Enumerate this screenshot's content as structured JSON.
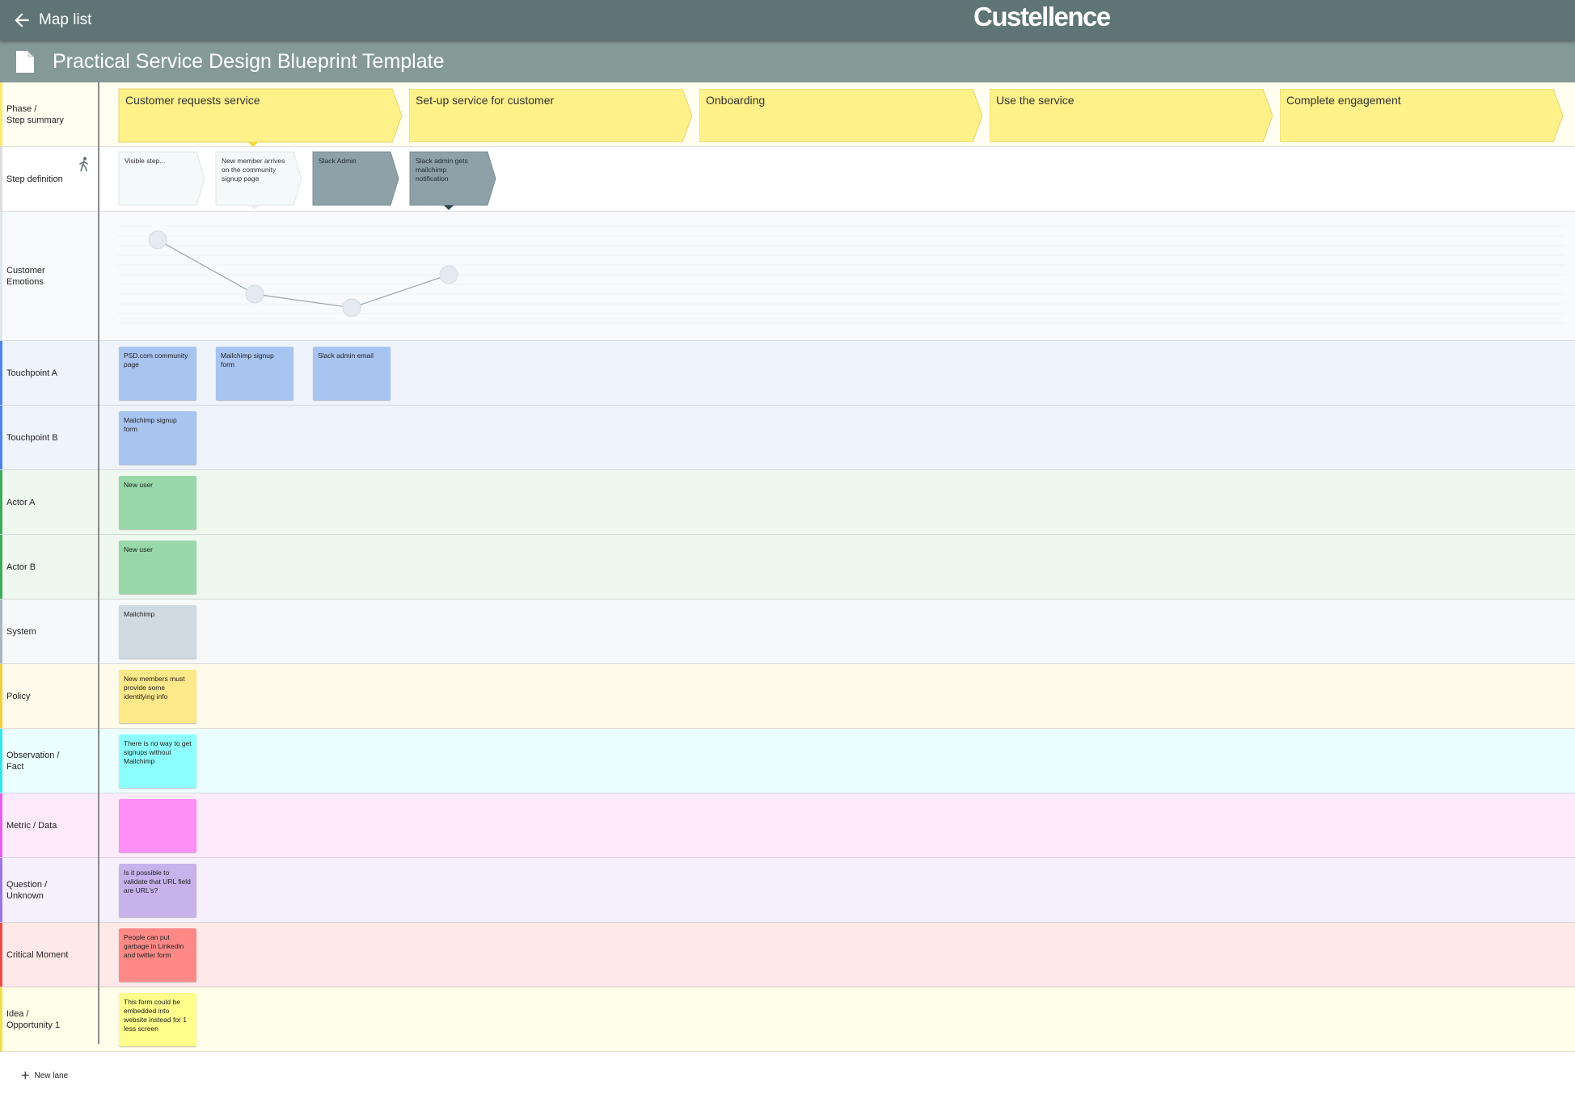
{
  "topbar": {
    "back_label": "Map list",
    "brand": "Custellence"
  },
  "map": {
    "title": "Practical Service Design Blueprint Template"
  },
  "lanes": [
    {
      "label": "Phase /\nStep summary",
      "accent": "#fce96a",
      "bg": "#fffef0"
    },
    {
      "label": "Step definition",
      "accent": "#dddddd",
      "bg": "#ffffff",
      "icon": "walk-icon"
    },
    {
      "label": "Customer\nEmotions",
      "accent": "#dde5ee",
      "bg": "#f9fafd"
    },
    {
      "label": "Touchpoint A",
      "accent": "#4e85e6",
      "bg": "#eff4fc"
    },
    {
      "label": "Touchpoint B",
      "accent": "#4e85e6",
      "bg": "#eff4fc"
    },
    {
      "label": "Actor A",
      "accent": "#3dab5c",
      "bg": "#eef8ef"
    },
    {
      "label": "Actor B",
      "accent": "#3dab5c",
      "bg": "#eef8ef"
    },
    {
      "label": "System",
      "accent": "#a7b6c2",
      "bg": "#f6f8fa"
    },
    {
      "label": "Policy",
      "accent": "#f5cf3b",
      "bg": "#fffbea"
    },
    {
      "label": "Observation /\nFact",
      "accent": "#33e6ee",
      "bg": "#eafffe"
    },
    {
      "label": "Metric / Data",
      "accent": "#e95ee8",
      "bg": "#fdebfb"
    },
    {
      "label": "Question /\nUnknown",
      "accent": "#9f74e0",
      "bg": "#f5f0fb"
    },
    {
      "label": "Critical Moment",
      "accent": "#ec4a4a",
      "bg": "#ffe9e8"
    },
    {
      "label": "Idea /\nOpportunity 1",
      "accent": "#efe24a",
      "bg": "#fffee8"
    }
  ],
  "phases": [
    "Customer requests service",
    "Set-up service for customer",
    "Onboarding",
    "Use the service",
    "Complete engagement"
  ],
  "steps": [
    {
      "label": "Visible step...",
      "style": "light"
    },
    {
      "label": "New member arrives on the community signup page",
      "style": "light"
    },
    {
      "label": "Slack Admin",
      "style": "dark"
    },
    {
      "label": "Slack admin gets mailchimp notification",
      "style": "dark"
    }
  ],
  "emotions": {
    "levels": [
      0.86,
      0.3,
      0.16,
      0.5
    ]
  },
  "cards": {
    "touchpoint_a": [
      "PSD.com community page",
      "Mailchimp signup form",
      "Slack admin email"
    ],
    "touchpoint_b": [
      "Mailchimp signup form"
    ],
    "actor_a": [
      "New user"
    ],
    "actor_b": [
      "New user"
    ],
    "system": [
      "Mailchimp"
    ],
    "policy": [
      "New members must provide some identifying info"
    ],
    "observation": [
      "There is no way to get signups without Mailchimp"
    ],
    "metric": [
      ""
    ],
    "question": [
      "Is it possible to validate that URL field are URL's?"
    ],
    "critical": [
      "People can put garbage in Linkedin and twitter form"
    ],
    "idea": [
      "This form could be embedded into website instead for 1 less screen"
    ]
  },
  "colors": {
    "touchpoint_card": "#a8c4f1",
    "actor_card": "#98d8ab",
    "system_card": "#cfdae2",
    "policy_card": "#fde88a",
    "observation_card": "#8cfefe",
    "metric_card": "#fe8ef8",
    "question_card": "#c7b2ec",
    "critical_card": "#fe8986",
    "idea_card": "#fefe8c",
    "phase_fill": "#fef18a",
    "step_light": "#f4fafa",
    "step_dark": "#8ea1a9"
  },
  "footer": {
    "new_lane_label": "New lane"
  }
}
